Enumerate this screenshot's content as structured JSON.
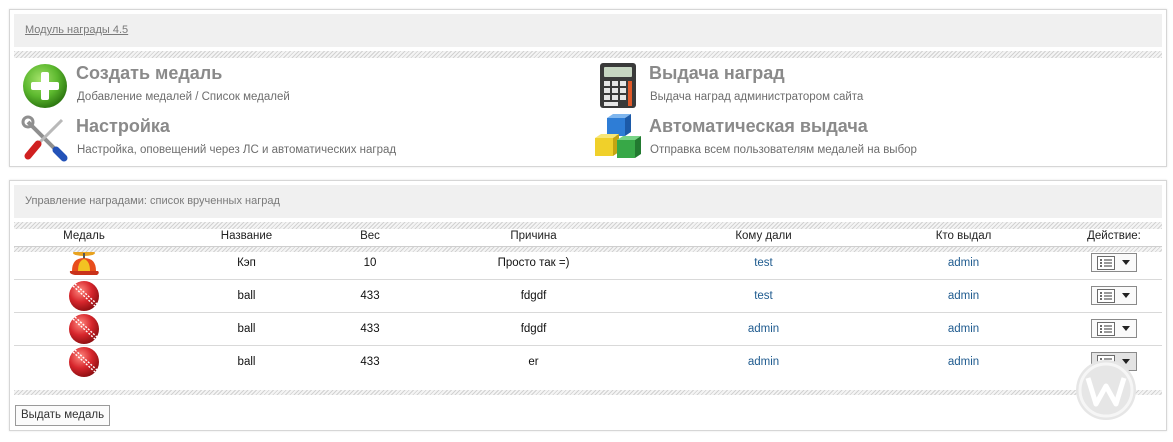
{
  "module_panel": {
    "title": "Модуль награды 4.5",
    "tiles": [
      {
        "icon": "plus-icon",
        "title": "Создать медаль",
        "desc": "Добавление медалей / Список медалей"
      },
      {
        "icon": "calculator-icon",
        "title": "Выдача наград",
        "desc": "Выдача наград администратором сайта"
      },
      {
        "icon": "tools-icon",
        "title": "Настройка",
        "desc": "Настройка, оповещений через ЛС и автоматических наград"
      },
      {
        "icon": "cubes-icon",
        "title": "Автоматическая выдача",
        "desc": "Отправка всем пользователям медалей на выбор"
      }
    ]
  },
  "awards_panel": {
    "title": "Управление наградами: список врученных наград",
    "columns": [
      "Медаль",
      "Название",
      "Вес",
      "Причина",
      "Кому дали",
      "Кто выдал",
      "Действие:"
    ],
    "rows": [
      {
        "medal_icon": "propeller-cap-icon",
        "name": "Кэп",
        "weight": "10",
        "reason": "Просто так =)",
        "to": "test",
        "by": "admin"
      },
      {
        "medal_icon": "cricket-ball-icon",
        "name": "ball",
        "weight": "433",
        "reason": "fdgdf",
        "to": "test",
        "by": "admin"
      },
      {
        "medal_icon": "cricket-ball-icon",
        "name": "ball",
        "weight": "433",
        "reason": "fdgdf",
        "to": "admin",
        "by": "admin"
      },
      {
        "medal_icon": "cricket-ball-icon",
        "name": "ball",
        "weight": "433",
        "reason": "er",
        "to": "admin",
        "by": "admin"
      }
    ],
    "give_button": "Выдать медаль"
  },
  "colors": {
    "link": "#1f5b8f",
    "tile_title": "#8a8a8a",
    "panel_header_bg": "#f0f0f0",
    "plus_green": "#5cb82e",
    "ball_red": "#d7262c"
  }
}
